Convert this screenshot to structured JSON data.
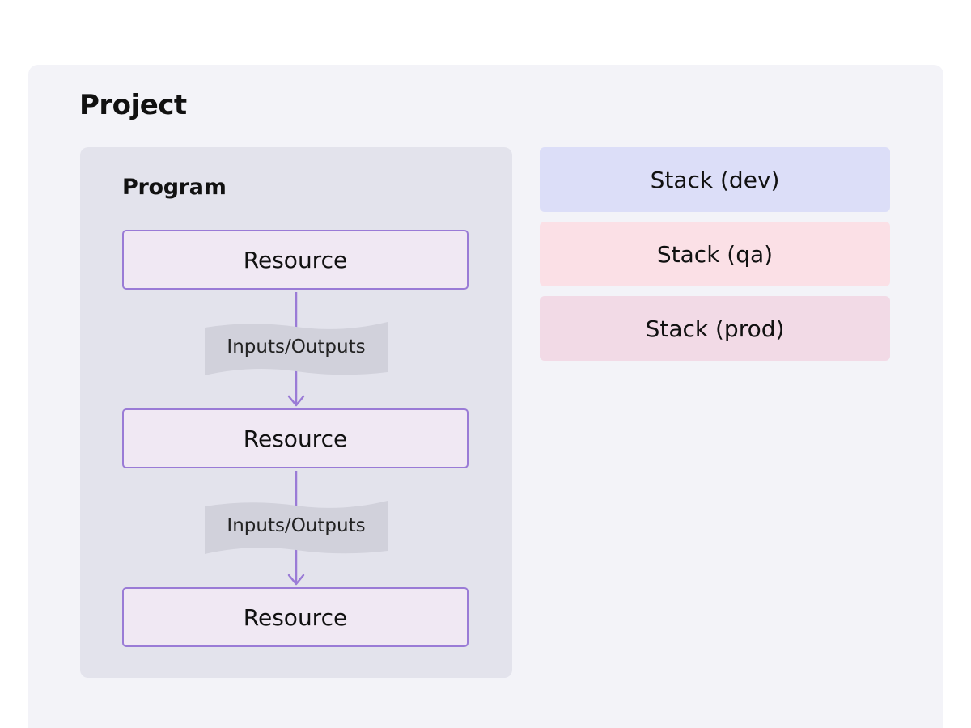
{
  "project": {
    "title": "Project"
  },
  "program": {
    "title": "Program",
    "resources": [
      "Resource",
      "Resource",
      "Resource"
    ],
    "connections": [
      {
        "label": "Inputs/Outputs"
      },
      {
        "label": "Inputs/Outputs"
      }
    ]
  },
  "stacks": [
    {
      "label": "Stack (dev)",
      "color": "#dcdef8"
    },
    {
      "label": "Stack (qa)",
      "color": "#fbe0e6"
    },
    {
      "label": "Stack (prod)",
      "color": "#f2dae6"
    }
  ],
  "colors": {
    "project_background": "#f3f3f8",
    "program_background": "#e3e3ec",
    "resource_fill": "#f0e8f3",
    "resource_border": "#9a7bd6",
    "io_label_fill": "#d1d1db"
  }
}
